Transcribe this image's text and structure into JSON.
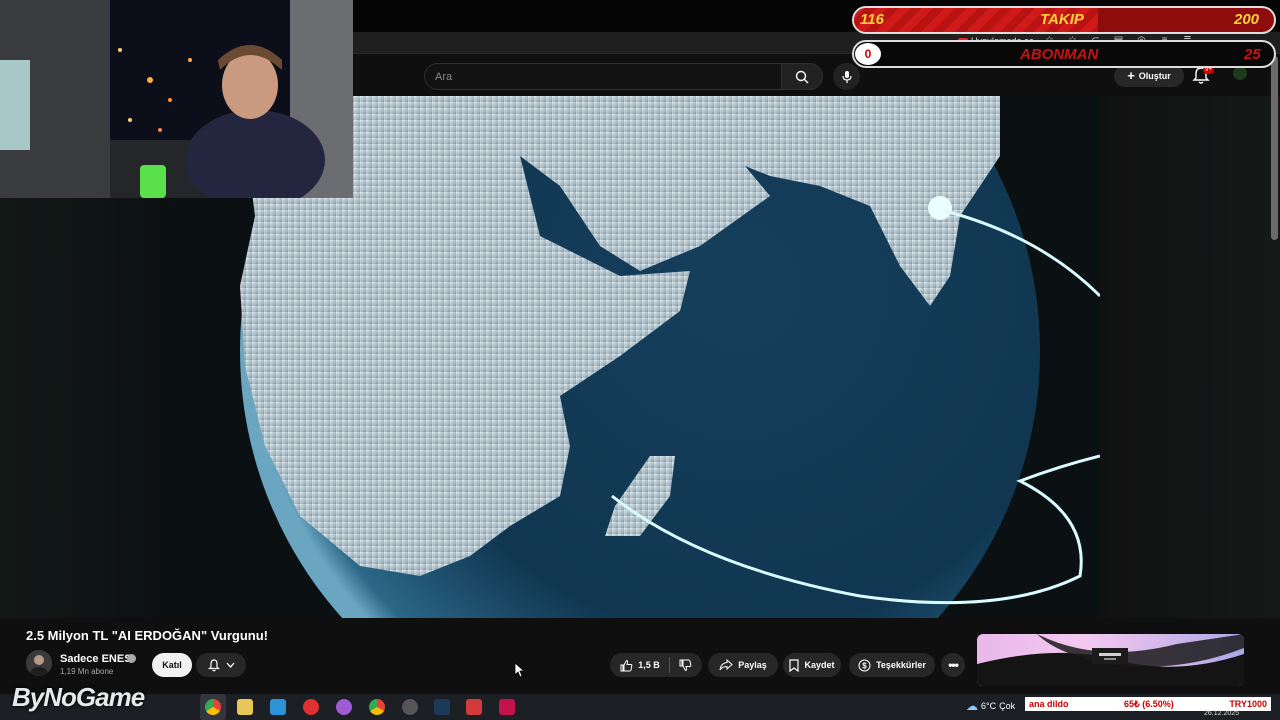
{
  "browser": {
    "open_in_app": "Uygulamada aç"
  },
  "search": {
    "placeholder": "Ara"
  },
  "header": {
    "create_label": "Oluştur",
    "notification_count": "9+"
  },
  "overlay": {
    "follow_label": "TAKIP",
    "follow_current": "116",
    "follow_goal": "200",
    "follow_progress": 0.58,
    "sub_label": "ABONMAN",
    "sub_current": "0",
    "sub_goal": "25",
    "sub_progress": 0.0
  },
  "video": {
    "title": "2.5 Milyon TL \"AI ERDOĞAN\" Vurgunu!",
    "channel": "Sadece ENES",
    "subscribers": "1,19 Mn abone",
    "join_label": "Katıl",
    "like_count": "1,5 B",
    "share_label": "Paylaş",
    "save_label": "Kaydet",
    "thanks_label": "Teşekkürler"
  },
  "taskbar": {
    "watermark": "ByNoGame",
    "weather_temp": "6°C",
    "weather_text": "Çok",
    "ticker_left": "ana dildo",
    "ticker_mid": "65₺ (6.50%)",
    "ticker_right": "TRY1000",
    "date": "26.12.2025"
  },
  "colors": {
    "overlay_red": "#c71212",
    "yt_bg": "#0f0f0f",
    "pill_bg": "#272727"
  }
}
